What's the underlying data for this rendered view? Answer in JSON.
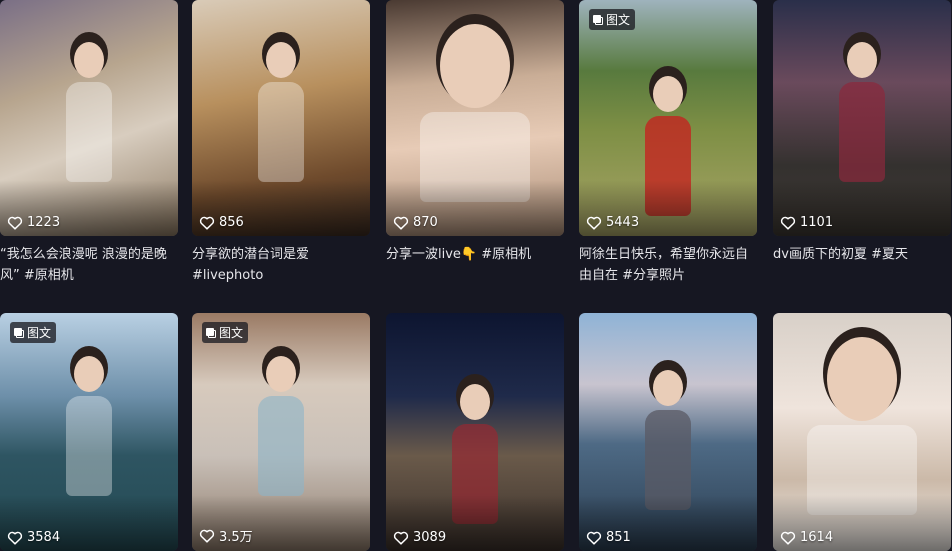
{
  "posts": [
    {
      "likes": "1223",
      "badge": "",
      "caption": "“我怎么会浪漫呢 浪漫的是晚风” #原相机"
    },
    {
      "likes": "856",
      "badge": "",
      "caption": "分享欲的潜台词是爱 #livephoto"
    },
    {
      "likes": "870",
      "badge": "",
      "caption": "分享一波live👇 #原相机"
    },
    {
      "likes": "5443",
      "badge": "图文",
      "caption": "阿徐生日快乐，希望你永远自由自在 #分享照片"
    },
    {
      "likes": "1101",
      "badge": "",
      "caption": "dv画质下的初夏 #夏天"
    },
    {
      "likes": "3584",
      "badge": "图文",
      "caption": ""
    },
    {
      "likes": "3.5万",
      "badge": "图文",
      "caption": ""
    },
    {
      "likes": "3089",
      "badge": "",
      "caption": ""
    },
    {
      "likes": "851",
      "badge": "",
      "caption": ""
    },
    {
      "likes": "1614",
      "badge": "",
      "caption": ""
    }
  ],
  "colors": {
    "background": "#161722",
    "text": "#e6e6ea",
    "badge_bg": "rgba(30,30,36,0.78)"
  },
  "icons": {
    "like": "heart-outline-icon",
    "gallery": "image-gallery-icon"
  }
}
